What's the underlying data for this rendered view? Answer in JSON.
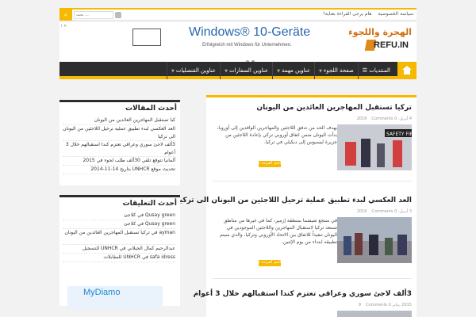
{
  "topbar": {
    "links": [
      "سياسة الخصوصية",
      "هام يرجى القراءة بعناية!"
    ],
    "search_placeholder": "بحث ..."
  },
  "ad": {
    "label": "i ×",
    "title": "Windows® 10-Geräte",
    "subtitle": "Erfolgreich mit Windows für Unternehmen."
  },
  "logo": {
    "arabic": "الهجرة واللجوء",
    "latin": "REFU.IN"
  },
  "nav": {
    "items": [
      "المنتديات",
      "صفحة اللجوء",
      "عناوين مهمة",
      "عناوين السفارات",
      "عناوين القنصليات"
    ]
  },
  "posts": [
    {
      "title": "تركيا تستقبل المهاجرين العائدين من اليونان",
      "date": "4 أبريل، 2016",
      "comments": "Comments 0",
      "excerpt": "بهدف الحد من تدفق اللاجئين والمهاجرين الوافدين إلى أوروبا، بدأت اليونان ضمن اتفاق أوروبي تركي بإعادة اللاجئين من جزيرة ليسبوس إلى ديكيلي في تركيا.",
      "readmore": "أكمل القراءة »"
    },
    {
      "title": "العد العكسي لبدء تطبيق عملية ترحيل اللاجئين من اليونان الى تركيا",
      "date": "3 أبريل، 2016",
      "comments": "Comments 0",
      "excerpt": "في منتجع شيشما بمنطقة إزمير، كما في غيرها من مناطق تستعد تركيا لاستقبال المهاجرين واللاجئين الموجودين في اليونان تنفيذاً للاتفاق بين الاتحاد الأوروبي وتركيا، والذي سيتم تطبيقه ابتداء من يوم الإثنين.",
      "readmore": "أكمل القراءة »"
    },
    {
      "title": "3ألف لاجئ سوري وعراقي تعتزم كندا استقبالهم خلال 3 أعوام",
      "date": "2015 ,يناير 9",
      "comments": "Comments 0"
    }
  ],
  "sidebar": {
    "recent_title": "أحدث المقالات",
    "recent": [
      "كيا تستقبل المهاجرين العائدين من اليونان",
      "العد العكسي لبدء تطبيق عملية ترحيل اللاجئين من اليونان الى تركيا",
      "3ألف لاجئ سوري وعراقي تعتزم كندا استقبالهم خلال 3 أعوام",
      "ألمانيا تتوقع تلقي 30ألف طلب لجوء في 2015",
      "تحديث موقع UNHCR  بتاريخ 14-11-2014"
    ],
    "comments_title": "أحدث التعليقات",
    "comments": [
      "Qusay green في كلاجئ",
      "Qusay green في كلاجئ",
      "ayman في تركيا تستقبل المهاجرين العائدين من اليونان",
      "عبدالرحيم كمال الجيلاني في UNHCR للتسجيل",
      "safa idress في UNHCR للمقابلات"
    ],
    "ad_text": "MyDiamo"
  },
  "colors": {
    "accent": "#f6b800",
    "nav_bg": "#2d2d2d",
    "ad_title": "#2a67b0"
  }
}
